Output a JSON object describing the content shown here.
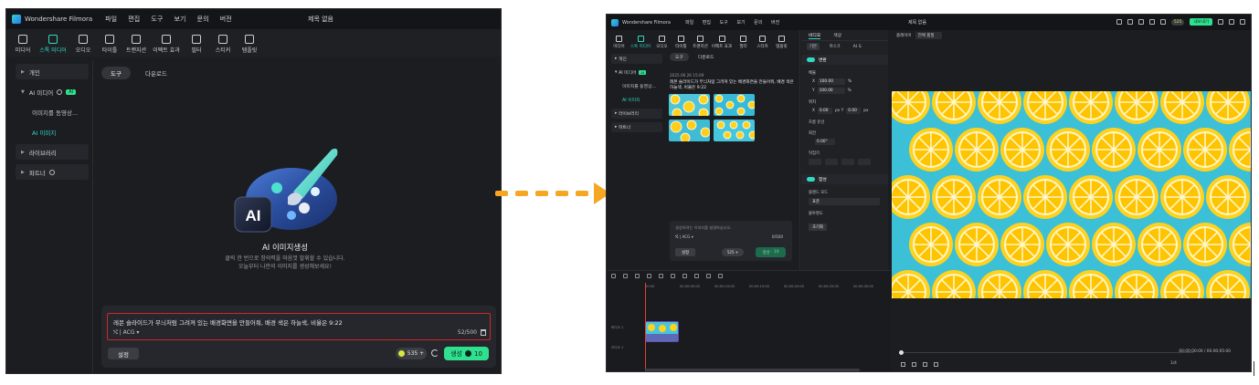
{
  "left_window": {
    "app_name": "Wondershare Filmora",
    "menu": [
      "파일",
      "편집",
      "도구",
      "보기",
      "문의",
      "버전"
    ],
    "window_title": "제목 없음",
    "tabs": [
      {
        "label": "미디어",
        "icon": "media-icon"
      },
      {
        "label": "스톡 미디어",
        "icon": "stock-media-icon",
        "active": true
      },
      {
        "label": "오디오",
        "icon": "audio-icon"
      },
      {
        "label": "타이틀",
        "icon": "title-icon"
      },
      {
        "label": "트랜지션",
        "icon": "transition-icon"
      },
      {
        "label": "이펙트 효과",
        "icon": "effects-icon"
      },
      {
        "label": "필터",
        "icon": "filter-icon"
      },
      {
        "label": "스티커",
        "icon": "sticker-icon"
      },
      {
        "label": "템플릿",
        "icon": "template-icon"
      }
    ],
    "sidebar": {
      "personal": "개인",
      "ai_media": "AI 미디어",
      "ai_badge": "AI",
      "image_to_video": "이미지를 동영상...",
      "ai_image": "AI 이미지",
      "library": "라이브러리",
      "partner": "파트너"
    },
    "subtabs": [
      "도구",
      "다운로드"
    ],
    "hero": {
      "icon_text": "AI",
      "title": "AI 이미지생성",
      "desc_line1": "클릭 한 번으로 창의력을 마음껏 발휘할 수 있습니다.",
      "desc_line2": "오늘부터 나만의 이미지를 생성해보세요!"
    },
    "prompt": {
      "text": "레몬 슬라이드가 무늬처럼 그려져 있는 배경화면을 만들어줘, 배경 색은 하늘색, 비율은 9:22",
      "style_tag": "ACG",
      "char_count": "52/500"
    },
    "settings_label": "설정",
    "credits": "535",
    "generate_label": "생성",
    "generate_cost": "10"
  },
  "right_window": {
    "app_name": "Wondershare Filmora",
    "menu": [
      "파일",
      "편집",
      "도구",
      "보기",
      "문의",
      "버전"
    ],
    "window_title": "제목 없음",
    "credit_badge": "525",
    "export_label": "내보내기",
    "tabs": [
      "미디어",
      "스톡 미디어",
      "오디오",
      "타이틀",
      "트랜지션",
      "이펙트 효과",
      "필터",
      "스티커",
      "템플릿"
    ],
    "sidebar": {
      "personal": "개인",
      "ai_media": "AI 미디어",
      "ai_badge": "AI",
      "image_to_video": "이미지를 동영상...",
      "ai_image": "AI 이미지",
      "library": "라이브러리",
      "partner": "파트너"
    },
    "subtabs": [
      "도구",
      "다운로드"
    ],
    "date": "2025.06.26 15:09",
    "prompt_echo": "레몬 슬라이드가 무늬처럼 그려져 있는 배경화면을 만들어줘, 배경 색은 하늘색, 비율은 9:22",
    "prompt_placeholder": "생성하려는 이미지를 설명하십시오.",
    "style_tag": "ACG",
    "char_count": "0/500",
    "settings_label": "설정",
    "credits": "525",
    "generate_label": "생성",
    "generate_cost": "10",
    "props": {
      "tabs": [
        "비디오",
        "색상"
      ],
      "subtabs": [
        "기본",
        "마스크",
        "AI 도"
      ],
      "transform": "변환",
      "scale": "배율",
      "scale_x": "100.00",
      "scale_y": "100.00",
      "scale_unit": "%",
      "position": "위치",
      "pos_x": "0.00",
      "pos_y": "0.00",
      "pos_unit": "px",
      "position_uniform": "흐름 유선",
      "rotate": "회전",
      "rotate_value": "0.00°",
      "flip": "뒤집기",
      "composite": "합성",
      "blend_mode": "블렌드 모드",
      "blend_value": "표준",
      "opacity": "불투명도",
      "reset": "초기화"
    },
    "player": {
      "label": "플레이어",
      "quality": "전체 품질",
      "time_current": "00:00:00:00",
      "time_total": "00:00:05:00",
      "zoom": "1/4"
    },
    "timeline": {
      "ruler": [
        "00:00",
        "00:00:05:00",
        "00:00:10:00",
        "00:00:15:00",
        "00:00:20:00",
        "00:00:25:00",
        "00:00:30:00"
      ],
      "video_track": "비디오 1",
      "audio_track": "오디오 1"
    }
  },
  "colors": {
    "accent_teal": "#33d8c4",
    "accent_green": "#2fe08f",
    "highlight_red": "#d02828",
    "arrow_orange": "#f5a623",
    "preview_sky": "#3cc0d8",
    "lemon": "#ffd21e"
  }
}
